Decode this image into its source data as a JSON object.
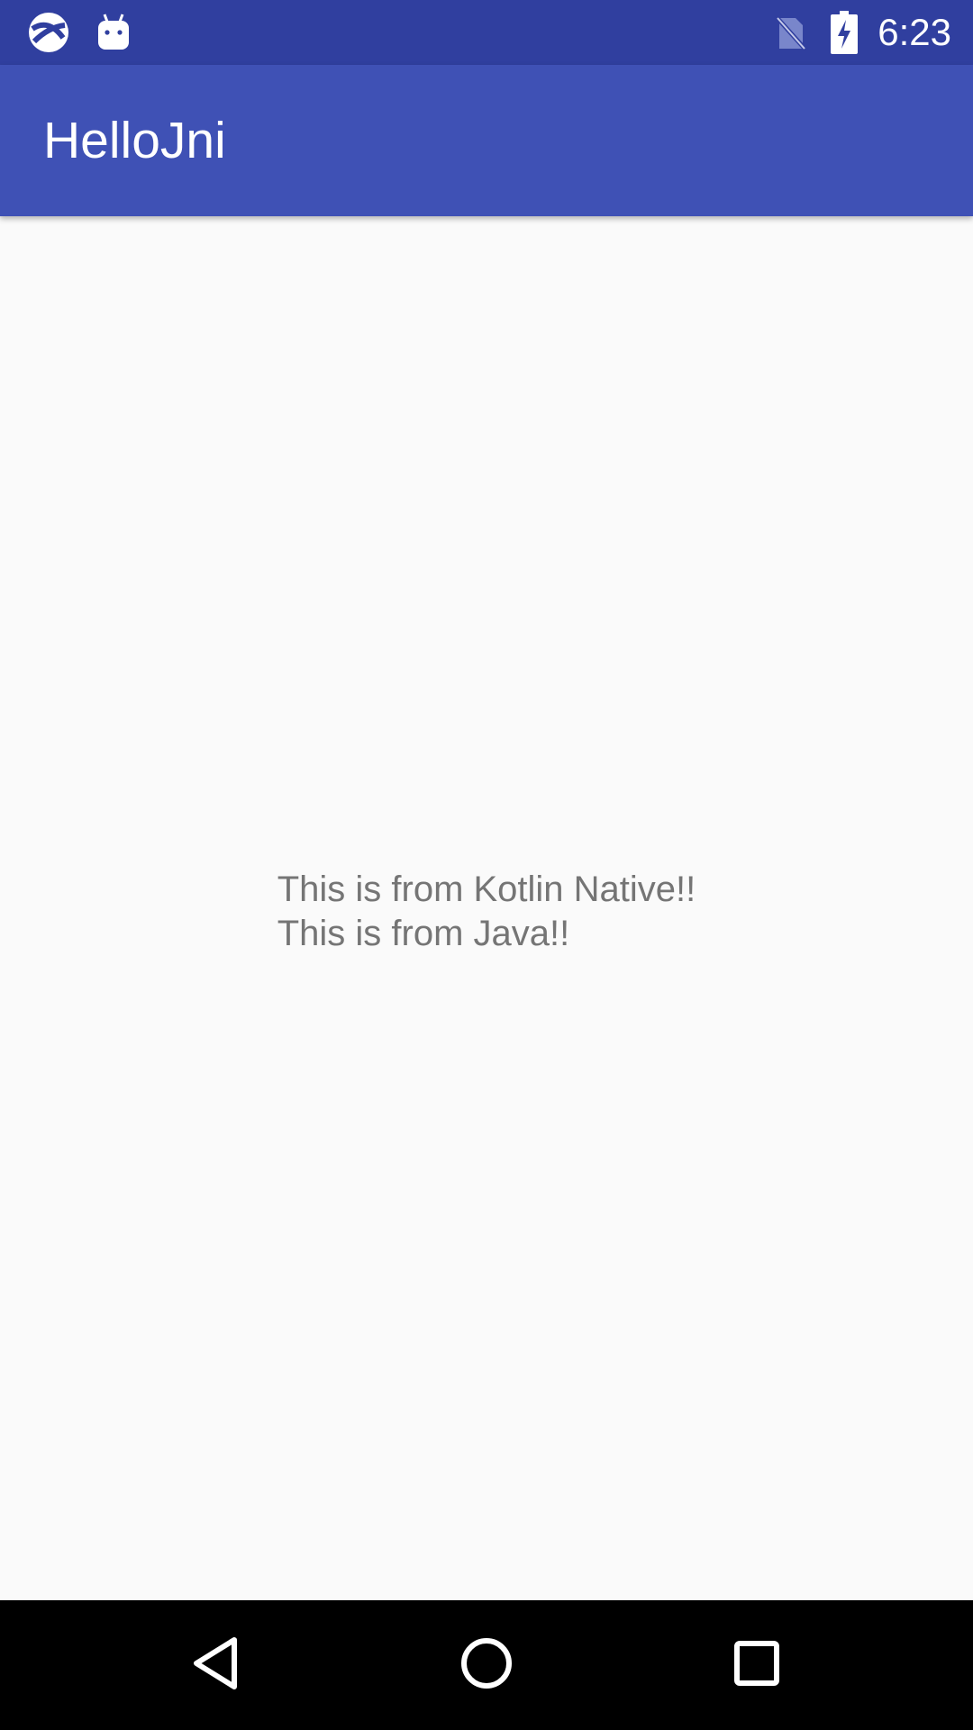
{
  "status_bar": {
    "time": "6:23",
    "icons": [
      "sync-icon",
      "android-icon",
      "no-sim-icon",
      "battery-charging-icon"
    ],
    "bg_color": "#303f9f"
  },
  "app_bar": {
    "title": "HelloJni",
    "bg_color": "#3f51b5"
  },
  "content": {
    "lines": [
      "This is from Kotlin Native!!",
      "This is from Java!!"
    ],
    "text_color": "#757575"
  },
  "nav_bar": {
    "buttons": [
      "back-icon",
      "home-icon",
      "recents-icon"
    ]
  }
}
